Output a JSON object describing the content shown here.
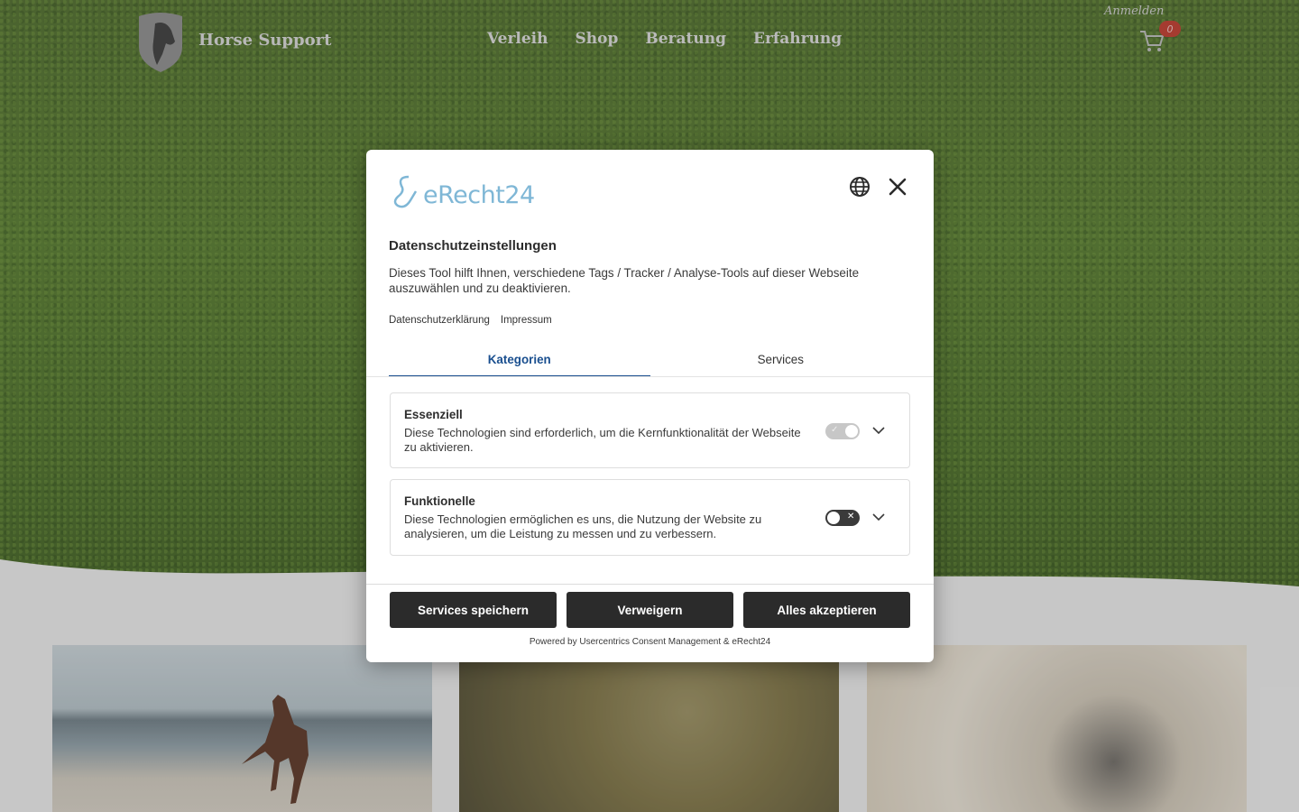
{
  "site": {
    "brand": "Horse Support",
    "nav": [
      "Verleih",
      "Shop",
      "Beratung",
      "Erfahrung"
    ],
    "login": "Anmelden",
    "cart_count": "0"
  },
  "consent": {
    "logo_text": "eRecht24",
    "title": "Datenschutzeinstellungen",
    "description": "Dieses Tool hilft Ihnen, verschiedene Tags / Tracker / Analyse-Tools auf dieser Webseite auszuwählen und zu deaktivieren.",
    "links": {
      "privacy": "Datenschutzerklärung",
      "imprint": "Impressum"
    },
    "tabs": [
      {
        "label": "Kategorien",
        "active": true
      },
      {
        "label": "Services",
        "active": false
      }
    ],
    "categories": [
      {
        "title": "Essenziell",
        "description": "Diese Technologien sind erforderlich, um die Kernfunktionalität der Webseite zu aktivieren.",
        "enabled": true,
        "locked": true
      },
      {
        "title": "Funktionelle",
        "description": "Diese Technologien ermöglichen es uns, die Nutzung der Website zu analysieren, um die Leistung zu messen und zu verbessern.",
        "enabled": false,
        "locked": false
      }
    ],
    "buttons": {
      "save": "Services speichern",
      "deny": "Verweigern",
      "accept": "Alles akzeptieren"
    },
    "powered_by": "Powered by Usercentrics Consent Management & eRecht24"
  },
  "colors": {
    "accent_tab": "#1a4f8f",
    "button_bg": "#2b2b2b",
    "cart_badge": "#c0392b",
    "logo_blue": "#7fb7d6"
  },
  "icons": {
    "language": "globe-icon",
    "close": "close-icon",
    "expand": "chevron-down-icon",
    "cart": "cart-icon"
  }
}
